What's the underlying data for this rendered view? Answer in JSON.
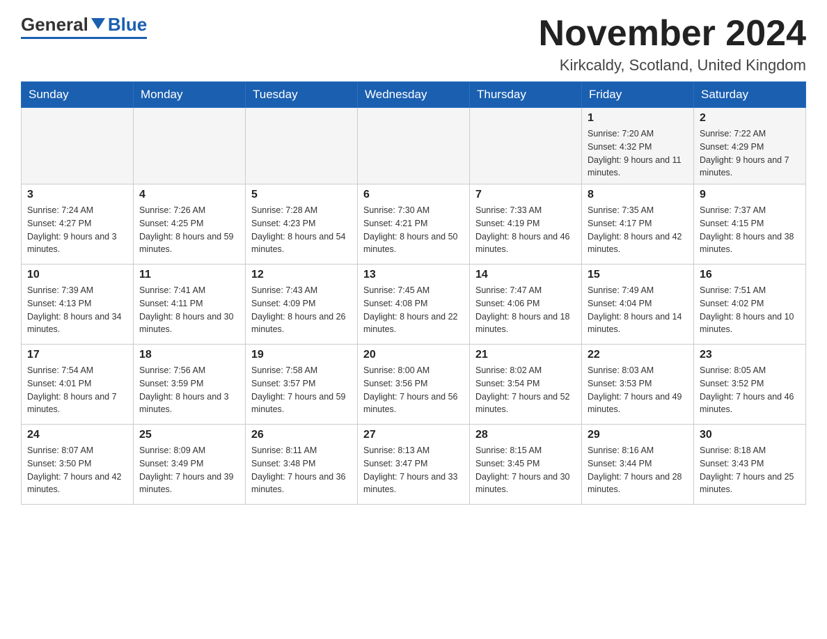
{
  "header": {
    "logo_general": "General",
    "logo_blue": "Blue",
    "month_title": "November 2024",
    "location": "Kirkcaldy, Scotland, United Kingdom"
  },
  "days_of_week": [
    "Sunday",
    "Monday",
    "Tuesday",
    "Wednesday",
    "Thursday",
    "Friday",
    "Saturday"
  ],
  "weeks": [
    [
      {
        "day": "",
        "sunrise": "",
        "sunset": "",
        "daylight": ""
      },
      {
        "day": "",
        "sunrise": "",
        "sunset": "",
        "daylight": ""
      },
      {
        "day": "",
        "sunrise": "",
        "sunset": "",
        "daylight": ""
      },
      {
        "day": "",
        "sunrise": "",
        "sunset": "",
        "daylight": ""
      },
      {
        "day": "",
        "sunrise": "",
        "sunset": "",
        "daylight": ""
      },
      {
        "day": "1",
        "sunrise": "Sunrise: 7:20 AM",
        "sunset": "Sunset: 4:32 PM",
        "daylight": "Daylight: 9 hours and 11 minutes."
      },
      {
        "day": "2",
        "sunrise": "Sunrise: 7:22 AM",
        "sunset": "Sunset: 4:29 PM",
        "daylight": "Daylight: 9 hours and 7 minutes."
      }
    ],
    [
      {
        "day": "3",
        "sunrise": "Sunrise: 7:24 AM",
        "sunset": "Sunset: 4:27 PM",
        "daylight": "Daylight: 9 hours and 3 minutes."
      },
      {
        "day": "4",
        "sunrise": "Sunrise: 7:26 AM",
        "sunset": "Sunset: 4:25 PM",
        "daylight": "Daylight: 8 hours and 59 minutes."
      },
      {
        "day": "5",
        "sunrise": "Sunrise: 7:28 AM",
        "sunset": "Sunset: 4:23 PM",
        "daylight": "Daylight: 8 hours and 54 minutes."
      },
      {
        "day": "6",
        "sunrise": "Sunrise: 7:30 AM",
        "sunset": "Sunset: 4:21 PM",
        "daylight": "Daylight: 8 hours and 50 minutes."
      },
      {
        "day": "7",
        "sunrise": "Sunrise: 7:33 AM",
        "sunset": "Sunset: 4:19 PM",
        "daylight": "Daylight: 8 hours and 46 minutes."
      },
      {
        "day": "8",
        "sunrise": "Sunrise: 7:35 AM",
        "sunset": "Sunset: 4:17 PM",
        "daylight": "Daylight: 8 hours and 42 minutes."
      },
      {
        "day": "9",
        "sunrise": "Sunrise: 7:37 AM",
        "sunset": "Sunset: 4:15 PM",
        "daylight": "Daylight: 8 hours and 38 minutes."
      }
    ],
    [
      {
        "day": "10",
        "sunrise": "Sunrise: 7:39 AM",
        "sunset": "Sunset: 4:13 PM",
        "daylight": "Daylight: 8 hours and 34 minutes."
      },
      {
        "day": "11",
        "sunrise": "Sunrise: 7:41 AM",
        "sunset": "Sunset: 4:11 PM",
        "daylight": "Daylight: 8 hours and 30 minutes."
      },
      {
        "day": "12",
        "sunrise": "Sunrise: 7:43 AM",
        "sunset": "Sunset: 4:09 PM",
        "daylight": "Daylight: 8 hours and 26 minutes."
      },
      {
        "day": "13",
        "sunrise": "Sunrise: 7:45 AM",
        "sunset": "Sunset: 4:08 PM",
        "daylight": "Daylight: 8 hours and 22 minutes."
      },
      {
        "day": "14",
        "sunrise": "Sunrise: 7:47 AM",
        "sunset": "Sunset: 4:06 PM",
        "daylight": "Daylight: 8 hours and 18 minutes."
      },
      {
        "day": "15",
        "sunrise": "Sunrise: 7:49 AM",
        "sunset": "Sunset: 4:04 PM",
        "daylight": "Daylight: 8 hours and 14 minutes."
      },
      {
        "day": "16",
        "sunrise": "Sunrise: 7:51 AM",
        "sunset": "Sunset: 4:02 PM",
        "daylight": "Daylight: 8 hours and 10 minutes."
      }
    ],
    [
      {
        "day": "17",
        "sunrise": "Sunrise: 7:54 AM",
        "sunset": "Sunset: 4:01 PM",
        "daylight": "Daylight: 8 hours and 7 minutes."
      },
      {
        "day": "18",
        "sunrise": "Sunrise: 7:56 AM",
        "sunset": "Sunset: 3:59 PM",
        "daylight": "Daylight: 8 hours and 3 minutes."
      },
      {
        "day": "19",
        "sunrise": "Sunrise: 7:58 AM",
        "sunset": "Sunset: 3:57 PM",
        "daylight": "Daylight: 7 hours and 59 minutes."
      },
      {
        "day": "20",
        "sunrise": "Sunrise: 8:00 AM",
        "sunset": "Sunset: 3:56 PM",
        "daylight": "Daylight: 7 hours and 56 minutes."
      },
      {
        "day": "21",
        "sunrise": "Sunrise: 8:02 AM",
        "sunset": "Sunset: 3:54 PM",
        "daylight": "Daylight: 7 hours and 52 minutes."
      },
      {
        "day": "22",
        "sunrise": "Sunrise: 8:03 AM",
        "sunset": "Sunset: 3:53 PM",
        "daylight": "Daylight: 7 hours and 49 minutes."
      },
      {
        "day": "23",
        "sunrise": "Sunrise: 8:05 AM",
        "sunset": "Sunset: 3:52 PM",
        "daylight": "Daylight: 7 hours and 46 minutes."
      }
    ],
    [
      {
        "day": "24",
        "sunrise": "Sunrise: 8:07 AM",
        "sunset": "Sunset: 3:50 PM",
        "daylight": "Daylight: 7 hours and 42 minutes."
      },
      {
        "day": "25",
        "sunrise": "Sunrise: 8:09 AM",
        "sunset": "Sunset: 3:49 PM",
        "daylight": "Daylight: 7 hours and 39 minutes."
      },
      {
        "day": "26",
        "sunrise": "Sunrise: 8:11 AM",
        "sunset": "Sunset: 3:48 PM",
        "daylight": "Daylight: 7 hours and 36 minutes."
      },
      {
        "day": "27",
        "sunrise": "Sunrise: 8:13 AM",
        "sunset": "Sunset: 3:47 PM",
        "daylight": "Daylight: 7 hours and 33 minutes."
      },
      {
        "day": "28",
        "sunrise": "Sunrise: 8:15 AM",
        "sunset": "Sunset: 3:45 PM",
        "daylight": "Daylight: 7 hours and 30 minutes."
      },
      {
        "day": "29",
        "sunrise": "Sunrise: 8:16 AM",
        "sunset": "Sunset: 3:44 PM",
        "daylight": "Daylight: 7 hours and 28 minutes."
      },
      {
        "day": "30",
        "sunrise": "Sunrise: 8:18 AM",
        "sunset": "Sunset: 3:43 PM",
        "daylight": "Daylight: 7 hours and 25 minutes."
      }
    ]
  ]
}
